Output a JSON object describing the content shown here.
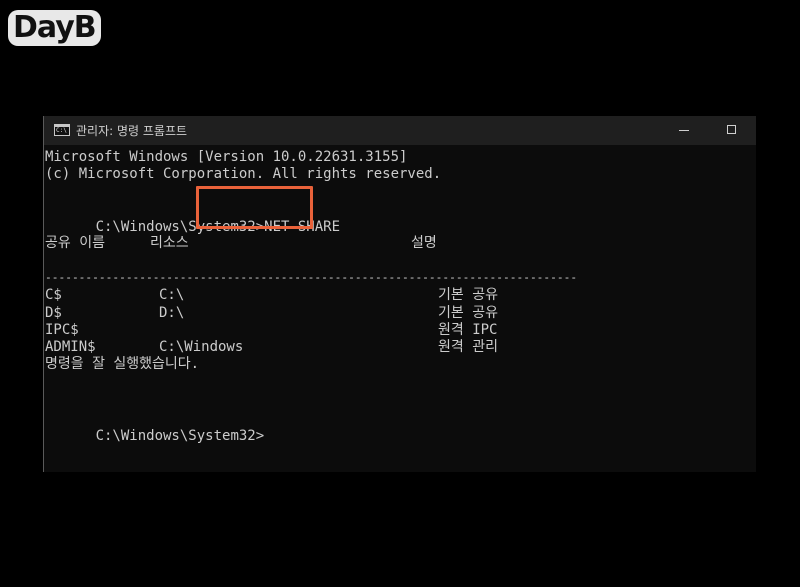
{
  "logo": {
    "text": "DayB"
  },
  "window": {
    "title": "관리자: 명령 프롬프트",
    "minimize_label": "",
    "maximize_label": ""
  },
  "console": {
    "banner_line1": "Microsoft Windows [Version 10.0.22631.3155]",
    "banner_line2": "(c) Microsoft Corporation. All rights reserved.",
    "prompt1": "C:\\Windows\\System32>",
    "command": "NET SHARE",
    "headers": {
      "name": "공유 이름",
      "resource": "리소스",
      "remark": "설명"
    },
    "separator": "-------------------------------------------------------------------------------",
    "rows": [
      {
        "name": "C$",
        "resource": "C:\\",
        "remark": "기본 공유"
      },
      {
        "name": "D$",
        "resource": "D:\\",
        "remark": "기본 공유"
      },
      {
        "name": "IPC$",
        "resource": "",
        "remark": "원격 IPC"
      },
      {
        "name": "ADMIN$",
        "resource": "C:\\Windows",
        "remark": "원격 관리"
      }
    ],
    "success_message": "명령을 잘 실행했습니다.",
    "prompt2": "C:\\Windows\\System32>"
  },
  "colors": {
    "highlight": "#e9623a",
    "console_text": "#cccccc",
    "console_bg": "#0c0c0c",
    "titlebar_bg": "#1f1f1f"
  }
}
